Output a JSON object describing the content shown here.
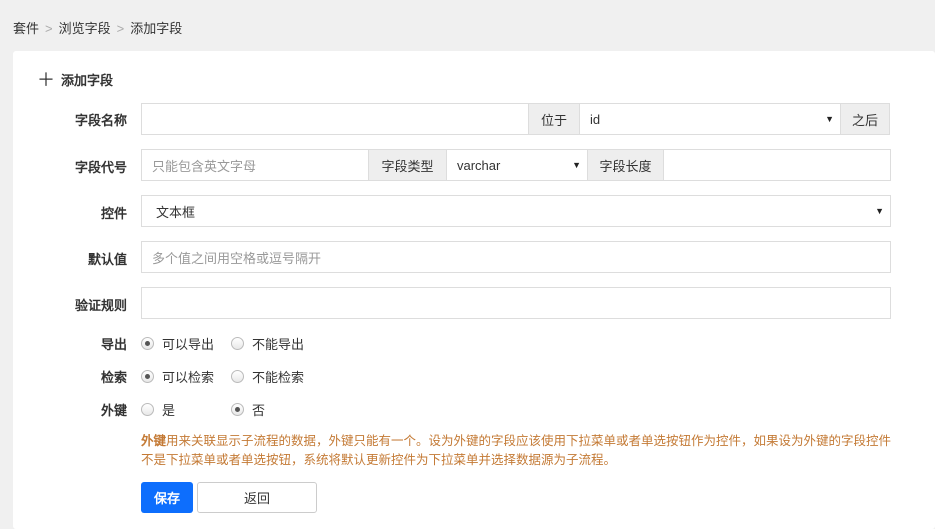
{
  "breadcrumb": [
    "套件",
    "浏览字段",
    "添加字段"
  ],
  "breadcrumb_sep": ">",
  "title": "添加字段",
  "fields": {
    "name": {
      "label": "字段名称",
      "value": "",
      "position_label": "位于",
      "position_value": "id",
      "after_label": "之后"
    },
    "code": {
      "label": "字段代号",
      "placeholder": "只能包含英文字母",
      "type_label": "字段类型",
      "type_value": "varchar",
      "length_label": "字段长度",
      "length_value": ""
    },
    "control": {
      "label": "控件",
      "value": "文本框"
    },
    "default": {
      "label": "默认值",
      "placeholder": "多个值之间用空格或逗号隔开"
    },
    "rules": {
      "label": "验证规则",
      "value": ""
    },
    "export": {
      "label": "导出",
      "options": [
        "可以导出",
        "不能导出"
      ],
      "selected": 0
    },
    "search": {
      "label": "检索",
      "options": [
        "可以检索",
        "不能检索"
      ],
      "selected": 0
    },
    "foreign": {
      "label": "外键",
      "options": [
        "是",
        "否"
      ],
      "selected": 1
    }
  },
  "note": {
    "bold": "外键",
    "text": "用来关联显示子流程的数据，外键只能有一个。设为外键的字段应该使用下拉菜单或者单选按钮作为控件，如果设为外键的字段控件不是下拉菜单或者单选按钮，系统将默认更新控件为下拉菜单并选择数据源为子流程。"
  },
  "buttons": {
    "save": "保存",
    "back": "返回"
  },
  "colors": {
    "primary": "#0d6efd",
    "note": "#c47a35"
  }
}
